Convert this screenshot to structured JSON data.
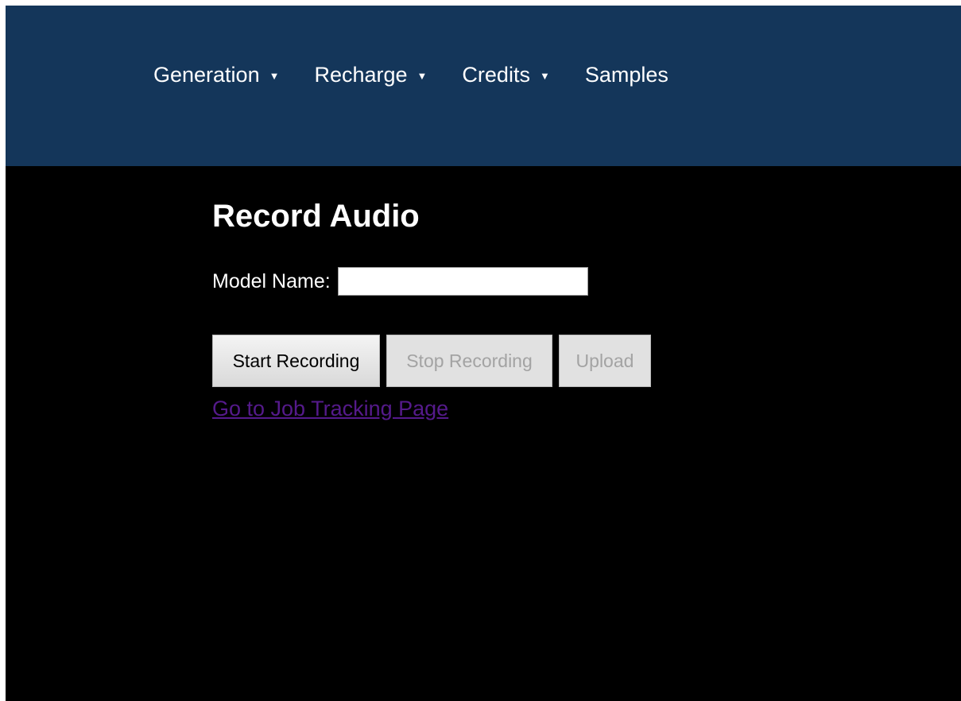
{
  "nav": {
    "items": [
      {
        "label": "Generation",
        "has_dropdown": true
      },
      {
        "label": "Recharge",
        "has_dropdown": true
      },
      {
        "label": "Credits",
        "has_dropdown": true
      },
      {
        "label": "Samples",
        "has_dropdown": false
      }
    ],
    "caret_glyph": "▼",
    "background_color": "#14365a"
  },
  "page": {
    "title": "Record Audio",
    "background_color": "#000000"
  },
  "form": {
    "model_name_label": "Model Name:",
    "model_name_value": "",
    "model_name_placeholder": ""
  },
  "actions": {
    "start_label": "Start Recording",
    "stop_label": "Stop Recording",
    "upload_label": "Upload",
    "stop_disabled": true,
    "upload_disabled": true
  },
  "links": {
    "job_tracking_label": "Go to Job Tracking Page",
    "color": "#551a8b"
  }
}
